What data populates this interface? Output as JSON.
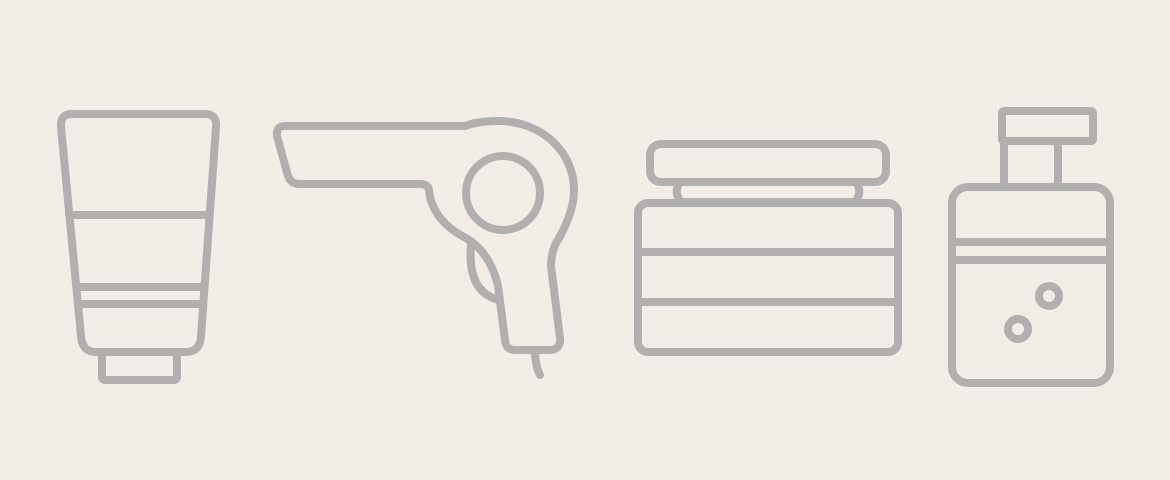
{
  "colors": {
    "background": "#f3ede8",
    "icon_stroke": "#b1b0ae"
  },
  "icons": [
    {
      "name": "cosmetic-tube-icon"
    },
    {
      "name": "hair-dryer-icon"
    },
    {
      "name": "cream-jar-icon"
    },
    {
      "name": "pump-bottle-icon"
    }
  ]
}
